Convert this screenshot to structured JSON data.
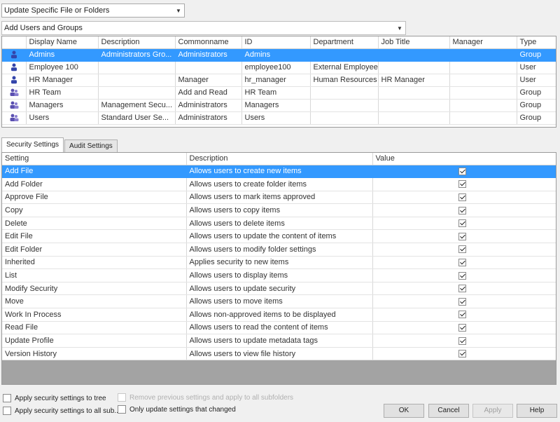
{
  "scope_combo": {
    "value": "Update Specific File or Folders"
  },
  "add_combo": {
    "value": "Add Users and Groups"
  },
  "users_table": {
    "columns": [
      "",
      "Display Name",
      "Description",
      "Commonname",
      "ID",
      "Department",
      "Job Title",
      "Manager",
      "Type"
    ],
    "rows": [
      {
        "icon": "user-icon",
        "name": "Admins",
        "description": "Administrators Gro...",
        "common": "Administrators",
        "id": "Admins",
        "department": "",
        "job": "",
        "manager": "",
        "type": "Group",
        "selected": true
      },
      {
        "icon": "user-icon",
        "name": "Employee 100",
        "description": "",
        "common": "",
        "id": "employee100",
        "department": "External Employee",
        "job": "",
        "manager": "",
        "type": "User",
        "selected": false
      },
      {
        "icon": "user-icon",
        "name": "HR Manager",
        "description": "",
        "common": "Manager",
        "id": "hr_manager",
        "department": "Human Resources",
        "job": "HR Manager",
        "manager": "",
        "type": "User",
        "selected": false
      },
      {
        "icon": "group-icon",
        "name": "HR Team",
        "description": "",
        "common": "Add and Read",
        "id": "HR Team",
        "department": "",
        "job": "",
        "manager": "",
        "type": "Group",
        "selected": false
      },
      {
        "icon": "group-icon",
        "name": "Managers",
        "description": "Management Secu...",
        "common": "Administrators",
        "id": "Managers",
        "department": "",
        "job": "",
        "manager": "",
        "type": "Group",
        "selected": false
      },
      {
        "icon": "group-icon",
        "name": "Users",
        "description": "Standard User Se...",
        "common": "Administrators",
        "id": "Users",
        "department": "",
        "job": "",
        "manager": "",
        "type": "Group",
        "selected": false
      }
    ]
  },
  "tabs": [
    {
      "label": "Security Settings",
      "active": true
    },
    {
      "label": "Audit Settings",
      "active": false
    }
  ],
  "settings_table": {
    "columns": [
      "Setting",
      "Description",
      "Value"
    ],
    "rows": [
      {
        "setting": "Add File",
        "description": "Allows users to create new items",
        "checked": true,
        "selected": true
      },
      {
        "setting": "Add Folder",
        "description": "Allows users to create folder items",
        "checked": true,
        "selected": false
      },
      {
        "setting": "Approve File",
        "description": "Allows users to mark items approved",
        "checked": true,
        "selected": false
      },
      {
        "setting": "Copy",
        "description": "Allows users to copy items",
        "checked": true,
        "selected": false
      },
      {
        "setting": "Delete",
        "description": "Allows users to delete items",
        "checked": true,
        "selected": false
      },
      {
        "setting": "Edit File",
        "description": "Allows users to update the content of items",
        "checked": true,
        "selected": false
      },
      {
        "setting": "Edit Folder",
        "description": "Allows users to modify folder settings",
        "checked": true,
        "selected": false
      },
      {
        "setting": "Inherited",
        "description": "Applies security to new items",
        "checked": true,
        "selected": false
      },
      {
        "setting": "List",
        "description": "Allows users to display items",
        "checked": true,
        "selected": false
      },
      {
        "setting": "Modify Security",
        "description": "Allows users to update security",
        "checked": true,
        "selected": false
      },
      {
        "setting": "Move",
        "description": "Allows users to move items",
        "checked": true,
        "selected": false
      },
      {
        "setting": "Work In Process",
        "description": "Allows non-approved items to be displayed",
        "checked": true,
        "selected": false
      },
      {
        "setting": "Read File",
        "description": "Allows users to read the content of items",
        "checked": true,
        "selected": false
      },
      {
        "setting": "Update Profile",
        "description": "Allows users to update metadata tags",
        "checked": true,
        "selected": false
      },
      {
        "setting": "Version History",
        "description": "Allows users to view file history",
        "checked": true,
        "selected": false
      }
    ]
  },
  "bottom": {
    "apply_tree": "Apply security settings to tree",
    "apply_all": "Apply security settings to all sub...",
    "remove_existing": "Remove previous settings and apply to all subfolders",
    "only_changed": "Only update settings that changed"
  },
  "buttons": {
    "ok": "OK",
    "cancel": "Cancel",
    "apply": "Apply",
    "help": "Help"
  },
  "colors": {
    "selection": "#3399ff",
    "user_icon": "#3344aa",
    "group_icon": "#5a4fb0"
  }
}
